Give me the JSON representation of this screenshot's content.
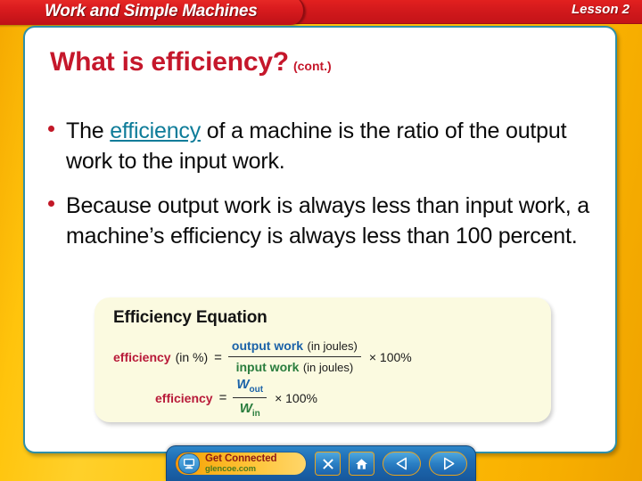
{
  "header": {
    "banner_title": "Work and Simple Machines",
    "lesson_label": "Lesson 2",
    "banner_color": "#D2191C",
    "frame_color": "#FFC20E"
  },
  "slide": {
    "title": "What is efficiency?",
    "title_suffix": "(cont.)",
    "title_color": "#C5172B",
    "bullets": [
      {
        "pre": "The ",
        "link": "efficiency",
        "post": " of a machine is the ratio of the output work to the input work.",
        "link_color": "#0E7C99"
      },
      {
        "pre": "",
        "link": "",
        "post": "Because output work is always less than input work, a machine’s efficiency is always less than 100 percent.",
        "link_color": ""
      }
    ]
  },
  "equation_panel": {
    "heading": "Efficiency Equation",
    "background": "#FBFAE0",
    "line1": {
      "term": "efficiency",
      "term_qualifier": "(in %)",
      "equals": "=",
      "numerator_bold": "output work",
      "numerator_unit": "(in joules)",
      "denominator_bold": "input work",
      "denominator_unit": "(in joules)",
      "tail": "× 100%",
      "term_color": "#B81A39",
      "numerator_color": "#1B62A8",
      "denominator_color": "#2A7D3E"
    },
    "line2": {
      "term": "efficiency",
      "equals": "=",
      "numerator_var": "W",
      "numerator_sub": "out",
      "denominator_var": "W",
      "denominator_sub": "in",
      "tail": "× 100%",
      "term_color": "#B81A39",
      "numerator_color": "#1B62A8",
      "denominator_color": "#2A7D3E"
    }
  },
  "navbar": {
    "get_connected_title": "Get Connected",
    "get_connected_sub": "glencoe.com",
    "buttons": [
      {
        "name": "close",
        "icon": "x-icon"
      },
      {
        "name": "home",
        "icon": "home-icon"
      },
      {
        "name": "previous",
        "icon": "triangle-left-icon"
      },
      {
        "name": "next",
        "icon": "triangle-right-icon"
      }
    ],
    "bar_color": "#1E6CB4"
  }
}
